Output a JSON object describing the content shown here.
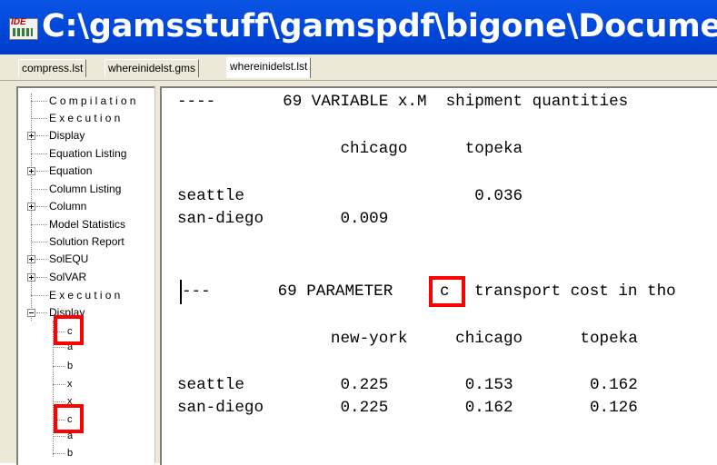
{
  "window": {
    "title": "C:\\gamsstuff\\gamspdf\\bigone\\Documen",
    "icon": "gams-ide-icon",
    "icon_text": "IDE"
  },
  "tabs": [
    {
      "label": "compress.lst",
      "active": false
    },
    {
      "label": "whereinidelst.gms",
      "active": false
    },
    {
      "label": "whereinidelst.lst",
      "active": true
    }
  ],
  "tree": {
    "items": [
      {
        "label": "Compilation",
        "expander": "none"
      },
      {
        "label": "Execution",
        "expander": "none"
      },
      {
        "label": "Display",
        "expander": "plus"
      },
      {
        "label": "Equation Listing",
        "expander": "none"
      },
      {
        "label": "Equation",
        "expander": "plus"
      },
      {
        "label": "Column Listing",
        "expander": "none"
      },
      {
        "label": "Column",
        "expander": "plus"
      },
      {
        "label": "Model Statistics",
        "expander": "none"
      },
      {
        "label": "Solution Report",
        "expander": "none"
      },
      {
        "label": "SolEQU",
        "expander": "plus"
      },
      {
        "label": "SolVAR",
        "expander": "plus"
      },
      {
        "label": "Execution",
        "expander": "none"
      },
      {
        "label": "Display",
        "expander": "minus"
      }
    ],
    "display_children": [
      "c",
      "a",
      "b",
      "x",
      "x",
      "c",
      "a",
      "b"
    ]
  },
  "listing": {
    "line1": "----       69 VARIABLE x.M  shipment quantities",
    "line2": "                 chicago      topeka",
    "line3": "seattle                        0.036",
    "line4": "san-diego        0.009",
    "line5_prefix": "---       69 PARAMETER",
    "line5_highlight": "c",
    "line5_suffix": "transport cost in tho",
    "line6": "                new-york     chicago      topeka",
    "line7": "seattle          0.225        0.153        0.162",
    "line8": "san-diego        0.225        0.162        0.126"
  },
  "colors": {
    "titlebar": "#0046d8",
    "highlight": "#ff0000",
    "chrome": "#ece9d8"
  }
}
